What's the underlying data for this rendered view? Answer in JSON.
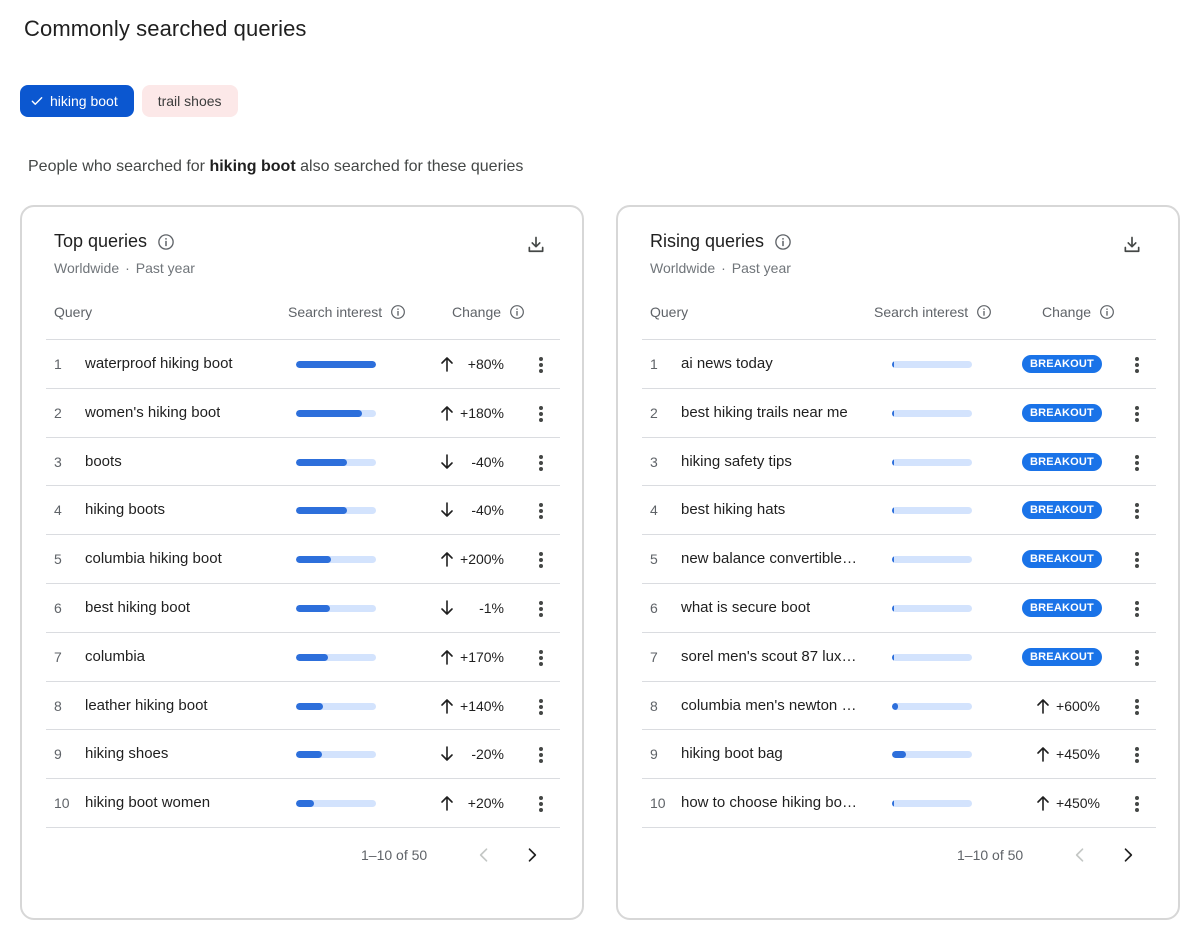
{
  "page_title": "Commonly searched queries",
  "chips": [
    {
      "label": "hiking boot",
      "selected": true
    },
    {
      "label": "trail shoes",
      "selected": false
    }
  ],
  "subtitle": {
    "prefix": "People who searched for",
    "term": "hiking boot",
    "suffix": "also searched for these queries"
  },
  "columns": {
    "query": "Query",
    "interest": "Search interest",
    "change": "Change"
  },
  "top": {
    "title": "Top queries",
    "region": "Worldwide",
    "separator": "·",
    "period": "Past year",
    "pagination": "1–10 of 50",
    "rows": [
      {
        "n": "1",
        "query": "waterproof hiking boot",
        "interest": 1.0,
        "dir": "up",
        "change": "+80%"
      },
      {
        "n": "2",
        "query": "women's hiking boot",
        "interest": 0.82,
        "dir": "up",
        "change": "+180%"
      },
      {
        "n": "3",
        "query": "boots",
        "interest": 0.64,
        "dir": "down",
        "change": "-40%"
      },
      {
        "n": "4",
        "query": "hiking boots",
        "interest": 0.64,
        "dir": "down",
        "change": "-40%"
      },
      {
        "n": "5",
        "query": "columbia hiking boot",
        "interest": 0.44,
        "dir": "up",
        "change": "+200%"
      },
      {
        "n": "6",
        "query": "best hiking boot",
        "interest": 0.42,
        "dir": "down",
        "change": "-1%"
      },
      {
        "n": "7",
        "query": "columbia",
        "interest": 0.4,
        "dir": "up",
        "change": "+170%"
      },
      {
        "n": "8",
        "query": "leather hiking boot",
        "interest": 0.34,
        "dir": "up",
        "change": "+140%"
      },
      {
        "n": "9",
        "query": "hiking shoes",
        "interest": 0.32,
        "dir": "down",
        "change": "-20%"
      },
      {
        "n": "10",
        "query": "hiking boot women",
        "interest": 0.23,
        "dir": "up",
        "change": "+20%"
      }
    ]
  },
  "rising": {
    "title": "Rising queries",
    "region": "Worldwide",
    "separator": "·",
    "period": "Past year",
    "pagination": "1–10 of 50",
    "rows": [
      {
        "n": "1",
        "query": "ai news today",
        "interest": 0.02,
        "dir": "",
        "change": "",
        "badge": "BREAKOUT"
      },
      {
        "n": "2",
        "query": "best hiking trails near me",
        "interest": 0.02,
        "dir": "",
        "change": "",
        "badge": "BREAKOUT"
      },
      {
        "n": "3",
        "query": "hiking safety tips",
        "interest": 0.02,
        "dir": "",
        "change": "",
        "badge": "BREAKOUT"
      },
      {
        "n": "4",
        "query": "best hiking hats",
        "interest": 0.01,
        "dir": "",
        "change": "",
        "badge": "BREAKOUT"
      },
      {
        "n": "5",
        "query": "new balance convertible …",
        "interest": 0.01,
        "dir": "",
        "change": "",
        "badge": "BREAKOUT"
      },
      {
        "n": "6",
        "query": "what is secure boot",
        "interest": 0.01,
        "dir": "",
        "change": "",
        "badge": "BREAKOUT"
      },
      {
        "n": "7",
        "query": "sorel men's scout 87 lux …",
        "interest": 0.01,
        "dir": "",
        "change": "",
        "badge": "BREAKOUT"
      },
      {
        "n": "8",
        "query": "columbia men's newton ri…",
        "interest": 0.08,
        "dir": "up",
        "change": "+600%",
        "badge": ""
      },
      {
        "n": "9",
        "query": "hiking boot bag",
        "interest": 0.18,
        "dir": "up",
        "change": "+450%",
        "badge": ""
      },
      {
        "n": "10",
        "query": "how to choose hiking boo…",
        "interest": 0.02,
        "dir": "up",
        "change": "+450%",
        "badge": ""
      }
    ]
  },
  "colors": {
    "accent": "#0b57d0",
    "bar_fill": "#2d6fdb",
    "bar_track": "#d3e3fd",
    "badge": "#1a73e8"
  },
  "icons": {
    "check": "check-icon",
    "info": "info-icon",
    "download": "download-icon",
    "more": "more-vert-icon",
    "prev": "chevron-left-icon",
    "next": "chevron-right-icon",
    "up": "arrow-up-icon",
    "down": "arrow-down-icon"
  }
}
